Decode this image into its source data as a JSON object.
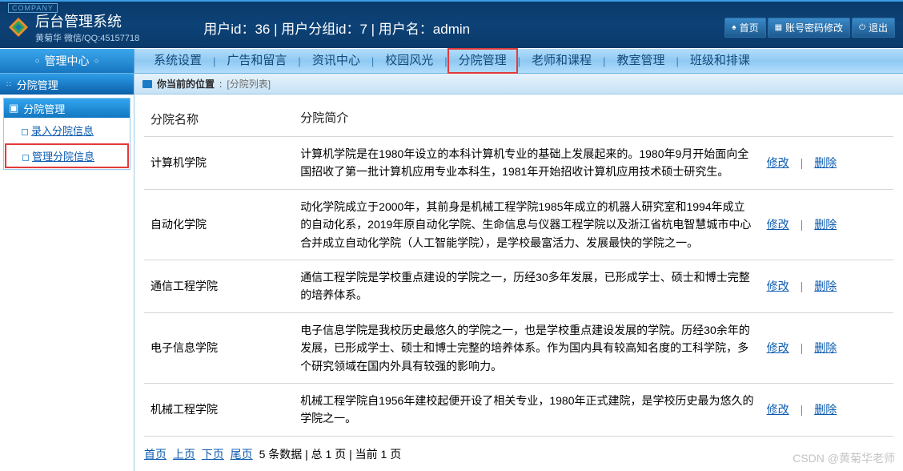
{
  "header": {
    "company_tag": "COMPANY",
    "title": "后台管理系统",
    "subtitle": "黄菊华 微信/QQ:45157718",
    "user_info": "用户id：36 | 用户分组id：7 | 用户名：admin",
    "buttons": {
      "home": "首页",
      "pwd": "账号密码修改",
      "logout": "退出"
    }
  },
  "nav": {
    "center": "管理中心",
    "items": [
      "系统设置",
      "广告和留言",
      "资讯中心",
      "校园风光",
      "分院管理",
      "老师和课程",
      "教室管理",
      "班级和排课"
    ],
    "active_index": 4
  },
  "sidebar": {
    "header": "分院管理",
    "panel_title": "分院管理",
    "items": [
      {
        "label": "录入分院信息",
        "active": false
      },
      {
        "label": "管理分院信息",
        "active": true
      }
    ]
  },
  "breadcrumb": {
    "label": "你当前的位置",
    "value": "[分院列表]"
  },
  "table": {
    "headers": {
      "name": "分院名称",
      "intro": "分院简介"
    },
    "actions": {
      "edit": "修改",
      "delete": "删除"
    },
    "rows": [
      {
        "name": "计算机学院",
        "intro": "计算机学院是在1980年设立的本科计算机专业的基础上发展起来的。1980年9月开始面向全国招收了第一批计算机应用专业本科生，1981年开始招收计算机应用技术硕士研究生。"
      },
      {
        "name": "自动化学院",
        "intro": "动化学院成立于2000年，其前身是机械工程学院1985年成立的机器人研究室和1994年成立的自动化系，2019年原自动化学院、生命信息与仪器工程学院以及浙江省杭电智慧城市中心合并成立自动化学院（人工智能学院），是学校最富活力、发展最快的学院之一。"
      },
      {
        "name": "通信工程学院",
        "intro": "通信工程学院是学校重点建设的学院之一，历经30多年发展，已形成学士、硕士和博士完整的培养体系。"
      },
      {
        "name": "电子信息学院",
        "intro": "电子信息学院是我校历史最悠久的学院之一，也是学校重点建设发展的学院。历经30余年的发展，已形成学士、硕士和博士完整的培养体系。作为国内具有较高知名度的工科学院，多个研究领域在国内外具有较强的影响力。"
      },
      {
        "name": "机械工程学院",
        "intro": "机械工程学院自1956年建校起便开设了相关专业，1980年正式建院，是学校历史最为悠久的学院之一。"
      }
    ]
  },
  "pager": {
    "first": "首页",
    "prev": "上页",
    "next": "下页",
    "last": "尾页",
    "summary": "5 条数据 | 总 1 页 | 当前 1 页"
  },
  "watermark": "CSDN @黄菊华老师"
}
